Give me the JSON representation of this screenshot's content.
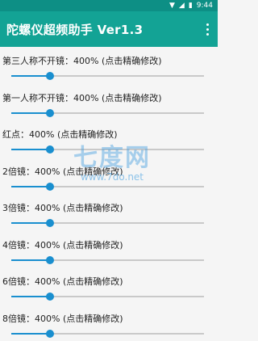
{
  "status": {
    "time": "9:44",
    "wifi_icon": "wifi-icon",
    "signal_icon": "signal-icon",
    "battery_icon": "battery-icon"
  },
  "app": {
    "title": "陀螺仪超频助手 Ver1.3",
    "menu_icon": "more-vertical-icon"
  },
  "settings": [
    {
      "label": "第三人称不开镜：400%  (点击精确修改)",
      "percent": 400
    },
    {
      "label": "第一人称不开镜：400%  (点击精确修改)",
      "percent": 400
    },
    {
      "label": "红点：400%  (点击精确修改)",
      "percent": 400
    },
    {
      "label": "2倍镜：400%  (点击精确修改)",
      "percent": 400
    },
    {
      "label": "3倍镜：400%  (点击精确修改)",
      "percent": 400
    },
    {
      "label": "4倍镜：400%  (点击精确修改)",
      "percent": 400
    },
    {
      "label": "6倍镜：400%  (点击精确修改)",
      "percent": 400
    },
    {
      "label": "8倍镜：400%  (点击精确修改)",
      "percent": 400
    }
  ],
  "watermark": {
    "big": "七度网",
    "small": "www.7do.net"
  },
  "colors": {
    "appbar": "#13a395",
    "statusbar": "#0d8f85",
    "accent": "#1a8fcf"
  }
}
